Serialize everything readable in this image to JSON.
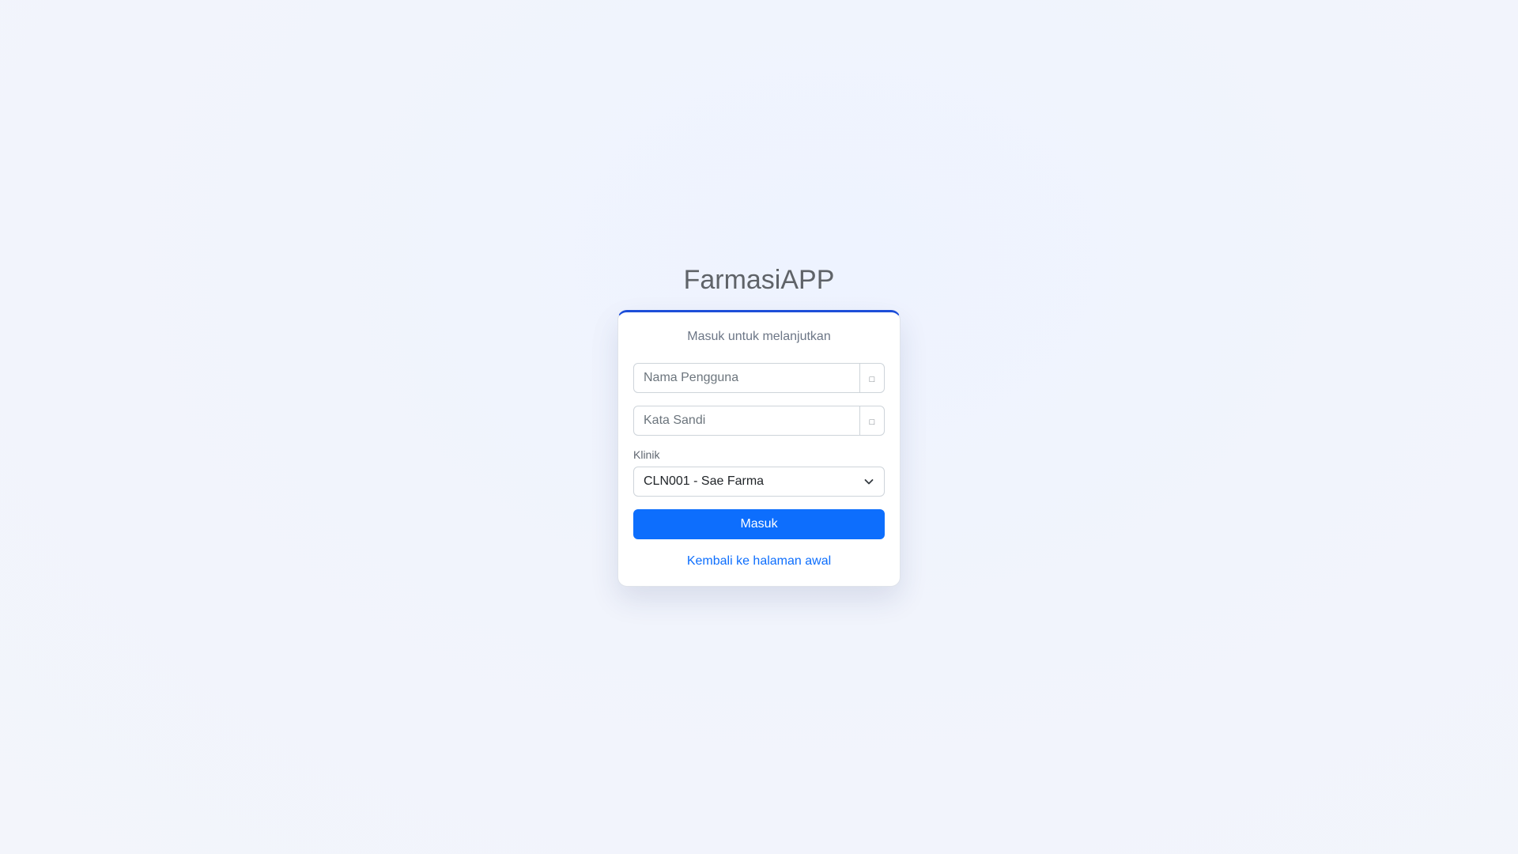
{
  "app": {
    "title": "FarmasiAPP"
  },
  "login": {
    "subtitle": "Masuk untuk melanjutkan",
    "username": {
      "placeholder": "Nama Pengguna",
      "value": "",
      "icon": "user-icon"
    },
    "password": {
      "placeholder": "Kata Sandi",
      "value": "",
      "icon": "lock-icon"
    },
    "clinic": {
      "label": "Klinik",
      "selected": "CLN001 - Sae Farma"
    },
    "submit_label": "Masuk",
    "back_link": "Kembali ke halaman awal"
  },
  "colors": {
    "primary": "#0d6efd",
    "card_top_border": "#1d4ed8",
    "title": "#5f6368"
  }
}
